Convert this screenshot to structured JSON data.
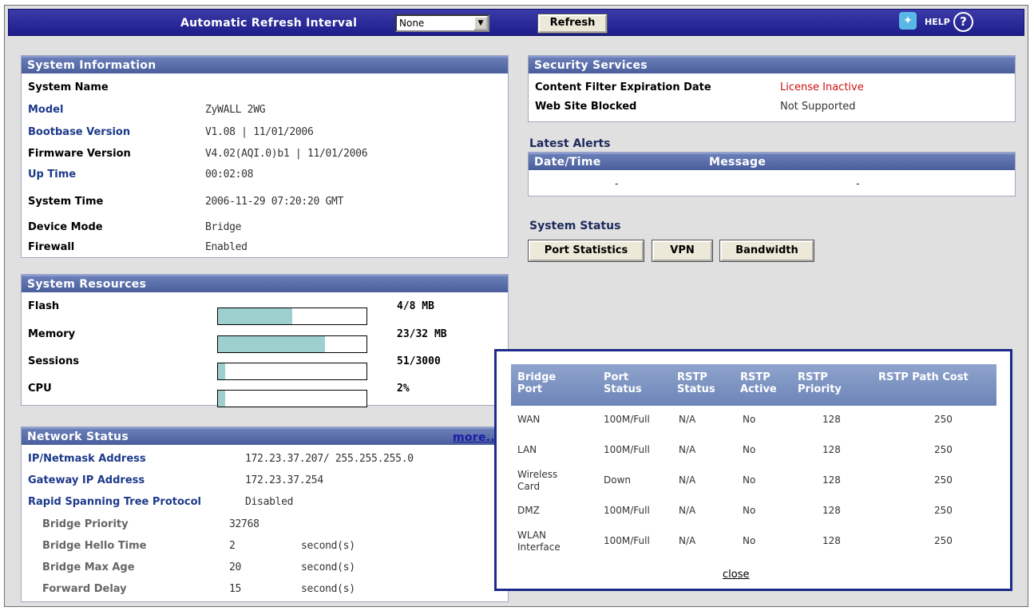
{
  "topbar": {
    "refresh_interval_label": "Automatic Refresh Interval",
    "refresh_interval_value": "None",
    "refresh_button": "Refresh",
    "help_label": "HELP",
    "help_q": "?"
  },
  "system_information": {
    "title": "System Information",
    "rows": [
      {
        "label": "System Name",
        "value": ""
      },
      {
        "label": "Model",
        "value": "ZyWALL 2WG"
      },
      {
        "label": "Bootbase Version",
        "value": "V1.08 | 11/01/2006"
      },
      {
        "label": "Firmware Version",
        "value": "V4.02(AQI.0)b1 | 11/01/2006"
      },
      {
        "label": "Up Time",
        "value": "00:02:08"
      },
      {
        "label": "System Time",
        "value": "2006-11-29 07:20:20 GMT"
      },
      {
        "label": "Device Mode",
        "value": "Bridge"
      },
      {
        "label": "Firewall",
        "value": "Enabled"
      }
    ]
  },
  "system_resources": {
    "title": "System Resources",
    "rows": [
      {
        "label": "Flash",
        "value": "4/8 MB",
        "fraction": 0.5
      },
      {
        "label": "Memory",
        "value": "23/32 MB",
        "fraction": 0.72
      },
      {
        "label": "Sessions",
        "value": "51/3000",
        "fraction": 0.05
      },
      {
        "label": "CPU",
        "value": "2%",
        "fraction": 0.05
      }
    ]
  },
  "network_status": {
    "title": "Network Status",
    "more_link": "more...",
    "rows": [
      {
        "label": "IP/Netmask Address",
        "value": "172.23.37.207/ 255.255.255.0",
        "unit": ""
      },
      {
        "label": "Gateway IP Address",
        "value": "172.23.37.254",
        "unit": ""
      },
      {
        "label": "Rapid Spanning Tree Protocol",
        "value": "Disabled",
        "unit": ""
      },
      {
        "label": "Bridge Priority",
        "value": "32768",
        "unit": ""
      },
      {
        "label": "Bridge Hello Time",
        "value": "2",
        "unit": "second(s)"
      },
      {
        "label": "Bridge Max Age",
        "value": "20",
        "unit": "second(s)"
      },
      {
        "label": "Forward Delay",
        "value": "15",
        "unit": "second(s)"
      }
    ]
  },
  "security_services": {
    "title": "Security Services",
    "rows": [
      {
        "label": "Content Filter Expiration Date",
        "value": "License Inactive"
      },
      {
        "label": "Web Site Blocked",
        "value": "Not Supported"
      }
    ]
  },
  "latest_alerts": {
    "title": "Latest Alerts",
    "col_datetime": "Date/Time",
    "col_message": "Message",
    "row_datetime": "-",
    "row_message": "-"
  },
  "system_status": {
    "title": "System Status",
    "buttons": [
      "Port Statistics",
      "VPN",
      "Bandwidth"
    ]
  },
  "bridge_popup": {
    "headers": {
      "port": "Bridge Port",
      "port_status": "Port Status",
      "rstp_status": "RSTP Status",
      "rstp_active": "RSTP Active",
      "rstp_priority": "RSTP Priority",
      "rstp_path_cost": "RSTP Path Cost"
    },
    "rows": [
      {
        "port": "WAN",
        "port_status": "100M/Full",
        "rstp_status": "N/A",
        "rstp_active": "No",
        "priority": "128",
        "path_cost": "250"
      },
      {
        "port": "LAN",
        "port_status": "100M/Full",
        "rstp_status": "N/A",
        "rstp_active": "No",
        "priority": "128",
        "path_cost": "250"
      },
      {
        "port": "Wireless Card",
        "port_status": "Down",
        "rstp_status": "N/A",
        "rstp_active": "No",
        "priority": "128",
        "path_cost": "250"
      },
      {
        "port": "DMZ",
        "port_status": "100M/Full",
        "rstp_status": "N/A",
        "rstp_active": "No",
        "priority": "128",
        "path_cost": "250"
      },
      {
        "port": "WLAN Interface",
        "port_status": "100M/Full",
        "rstp_status": "N/A",
        "rstp_active": "No",
        "priority": "128",
        "path_cost": "250"
      }
    ],
    "close": "close"
  },
  "colors": {
    "topbar": "#1c1c8a",
    "panel_header": "#4a5e9c",
    "license_inactive": "#d01010",
    "bar_fill": "#9ecfcf"
  }
}
